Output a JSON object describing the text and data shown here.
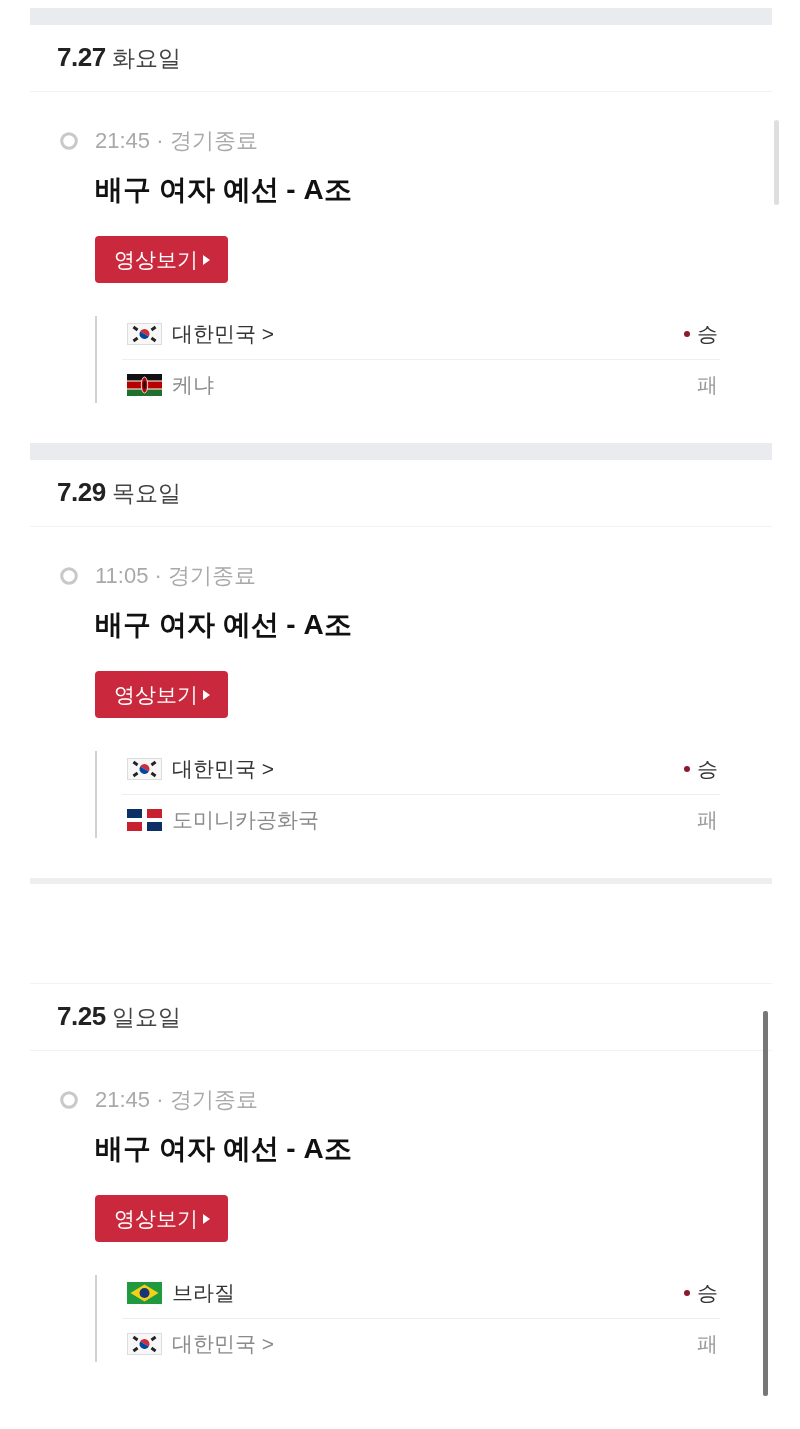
{
  "sections": [
    {
      "kind": "band",
      "date": "7.27",
      "weekday": "화요일",
      "scrollbar": {
        "kind": "light"
      },
      "matches": [
        {
          "info": "21:45 · 경기종료",
          "title": "배구 여자 예선 - A조",
          "button": "영상보기",
          "teams": [
            {
              "flag": {
                "kind": "kr"
              },
              "name": "대한민국",
              "chevron": ">",
              "winner": true,
              "result": "승"
            },
            {
              "flag": {
                "kind": "ke"
              },
              "name": "케냐",
              "winner": false,
              "result": "패"
            }
          ]
        }
      ]
    },
    {
      "kind": "band",
      "date": "7.29",
      "weekday": "목요일",
      "matches": [
        {
          "info": "11:05 · 경기종료",
          "title": "배구 여자 예선 - A조",
          "button": "영상보기",
          "teams": [
            {
              "flag": {
                "kind": "kr"
              },
              "name": "대한민국",
              "chevron": ">",
              "winner": true,
              "result": "승"
            },
            {
              "flag": {
                "kind": "do"
              },
              "name": "도미니카공화국",
              "winner": false,
              "result": "패"
            }
          ]
        }
      ]
    },
    {
      "kind": "gap",
      "date": "7.25",
      "weekday": "일요일",
      "scrollbar": {
        "kind": "dark"
      },
      "matches": [
        {
          "info": "21:45 · 경기종료",
          "title": "배구 여자 예선 - A조",
          "button": "영상보기",
          "teams": [
            {
              "flag": {
                "kind": "br"
              },
              "name": "브라질",
              "winner": true,
              "result": "승"
            },
            {
              "flag": {
                "kind": "kr"
              },
              "name": "대한민국",
              "chevron": ">",
              "winner": false,
              "result": "패"
            }
          ]
        }
      ]
    }
  ]
}
